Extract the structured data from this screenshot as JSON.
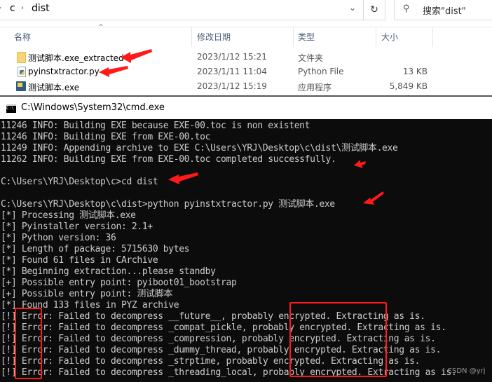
{
  "explorer": {
    "breadcrumb": [
      "c",
      "dist"
    ],
    "search_placeholder": "搜索\"dist\"",
    "columns": {
      "name": "名称",
      "date": "修改日期",
      "type": "类型",
      "size": "大小"
    },
    "files": [
      {
        "name": "测试脚本.exe_extracted",
        "date": "2023/1/12 15:21",
        "type": "文件夹",
        "size": "",
        "icon": "folder-icon"
      },
      {
        "name": "pyinstxtractor.py",
        "date": "2023/1/11 11:04",
        "type": "Python File",
        "size": "13 KB",
        "icon": "python-file-icon"
      },
      {
        "name": "测试脚本.exe",
        "date": "2023/1/12 15:19",
        "type": "应用程序",
        "size": "5,849 KB",
        "icon": "exe-icon"
      }
    ]
  },
  "cmd": {
    "title": "C:\\Windows\\System32\\cmd.exe",
    "lines": [
      "11246 INFO: Building EXE because EXE-00.toc is non existent",
      "11246 INFO: Building EXE from EXE-00.toc",
      "11249 INFO: Appending archive to EXE C:\\Users\\YRJ\\Desktop\\c\\dist\\测试脚本.exe",
      "11262 INFO: Building EXE from EXE-00.toc completed successfully.",
      "",
      "C:\\Users\\YRJ\\Desktop\\c>cd dist",
      "",
      "C:\\Users\\YRJ\\Desktop\\c\\dist>python pyinstxtractor.py 测试脚本.exe",
      "[*] Processing 测试脚本.exe",
      "[*] Pyinstaller version: 2.1+",
      "[*] Python version: 36",
      "[*] Length of package: 5715630 bytes",
      "[*] Found 61 files in CArchive",
      "[*] Beginning extraction...please standby",
      "[+] Possible entry point: pyiboot01_bootstrap",
      "[+] Possible entry point: 测试脚本",
      "[*] Found 133 files in PYZ archive",
      "[!] Error: Failed to decompress __future__, probably encrypted. Extracting as is.",
      "[!] Error: Failed to decompress _compat_pickle, probably encrypted. Extracting as is.",
      "[!] Error: Failed to decompress _compression, probably encrypted. Extracting as is.",
      "[!] Error: Failed to decompress _dummy_thread, probably encrypted. Extracting as is.",
      "[!] Error: Failed to decompress _strptime, probably encrypted. Extracting as is.",
      "[!] Error: Failed to decompress _threading_local, probably encrypted. Extracting as is."
    ]
  },
  "annotation_color": "#ff1a1a",
  "watermark": "CSDN @yrj"
}
